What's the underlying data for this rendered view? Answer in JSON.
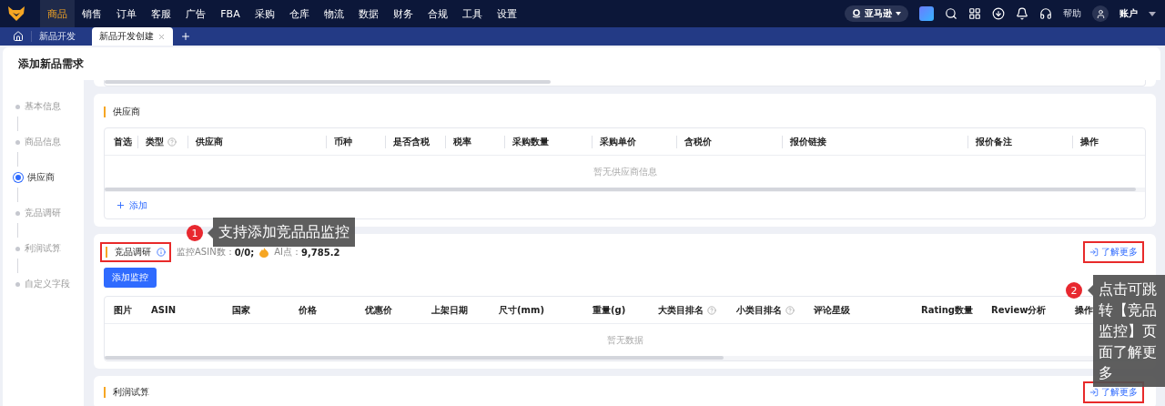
{
  "top_nav": {
    "items": [
      {
        "label": "商品",
        "selected": true
      },
      {
        "label": "销售",
        "selected": false
      },
      {
        "label": "订单",
        "selected": false
      },
      {
        "label": "客服",
        "selected": false
      },
      {
        "label": "广告",
        "selected": false
      },
      {
        "label": "FBA",
        "selected": false
      },
      {
        "label": "采购",
        "selected": false
      },
      {
        "label": "仓库",
        "selected": false
      },
      {
        "label": "物流",
        "selected": false
      },
      {
        "label": "数据",
        "selected": false
      },
      {
        "label": "财务",
        "selected": false
      },
      {
        "label": "合规",
        "selected": false
      },
      {
        "label": "工具",
        "selected": false
      },
      {
        "label": "设置",
        "selected": false
      }
    ],
    "platform": "亚马逊",
    "help": "帮助",
    "account": "账户"
  },
  "tabs": [
    {
      "label": "新品开发",
      "selected": false,
      "closable": false
    },
    {
      "label": "新品开发创建",
      "selected": true,
      "closable": true
    }
  ],
  "page_title": "添加新品需求",
  "steps": [
    {
      "label": "基本信息",
      "selected": false
    },
    {
      "label": "商品信息",
      "selected": false
    },
    {
      "label": "供应商",
      "selected": true
    },
    {
      "label": "竞品调研",
      "selected": false
    },
    {
      "label": "利润试算",
      "selected": false
    },
    {
      "label": "自定义字段",
      "selected": false
    }
  ],
  "supplier": {
    "title": "供应商",
    "columns": [
      {
        "label": "首选",
        "help": false
      },
      {
        "label": "类型",
        "help": true
      },
      {
        "label": "供应商",
        "help": false
      },
      {
        "label": "币种",
        "help": false
      },
      {
        "label": "是否含税",
        "help": false
      },
      {
        "label": "税率",
        "help": false
      },
      {
        "label": "采购数量",
        "help": false
      },
      {
        "label": "采购单价",
        "help": false
      },
      {
        "label": "含税价",
        "help": false
      },
      {
        "label": "报价链接",
        "help": false
      },
      {
        "label": "报价备注",
        "help": false
      },
      {
        "label": "操作",
        "help": false
      }
    ],
    "empty": "暂无供应商信息",
    "add": "添加"
  },
  "research": {
    "title": "竞品调研",
    "highlighted": true,
    "asin_label": "监控ASIN数：",
    "asin_value": "0/0;",
    "ai_label": "AI点：",
    "ai_value": "9,785.2",
    "more": "了解更多",
    "more_highlighted": true,
    "add_button": "添加监控",
    "columns": [
      {
        "label": "图片",
        "help": false
      },
      {
        "label": "ASIN",
        "help": false
      },
      {
        "label": "国家",
        "help": false
      },
      {
        "label": "价格",
        "help": false
      },
      {
        "label": "优惠价",
        "help": false
      },
      {
        "label": "上架日期",
        "help": false
      },
      {
        "label": "尺寸(mm)",
        "help": false
      },
      {
        "label": "重量(g)",
        "help": false
      },
      {
        "label": "大类目排名",
        "help": true
      },
      {
        "label": "小类目排名",
        "help": true
      },
      {
        "label": "评论星级",
        "help": false
      },
      {
        "label": "Rating数量",
        "help": false
      },
      {
        "label": "Review分析",
        "help": false
      },
      {
        "label": "操作",
        "help": false
      }
    ],
    "empty": "暂无数据"
  },
  "profit": {
    "title": "利润试算",
    "more": "了解更多",
    "more_highlighted": true
  },
  "annotations": [
    {
      "number": "1",
      "text": "支持添加竞品品监控"
    },
    {
      "number": "2",
      "text": "点击可跳转【竞品监控】页面了解更多"
    }
  ]
}
